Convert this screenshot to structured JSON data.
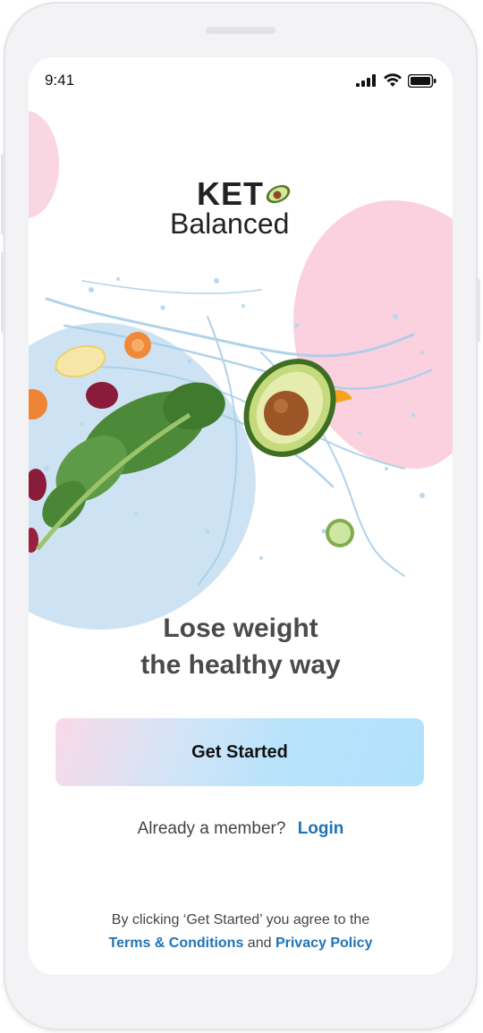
{
  "status_bar": {
    "time": "9:41",
    "icons": [
      "cellular-signal-icon",
      "wifi-icon",
      "battery-icon"
    ]
  },
  "brand": {
    "name_top": "KET",
    "name_bottom": "Balanced",
    "logo_icon": "avocado-icon"
  },
  "hero": {
    "illustration": "vegetables-water-splash-illustration"
  },
  "headline": {
    "line1": "Lose weight",
    "line2": "the healthy way"
  },
  "cta": {
    "label": "Get Started"
  },
  "member": {
    "prompt": "Already a member?",
    "login_label": "Login"
  },
  "legal": {
    "prefix": "By clicking ‘Get Started’ you agree to the",
    "terms_label": "Terms & Conditions",
    "and_text": "and",
    "privacy_label": "Privacy Policy"
  },
  "colors": {
    "accent_blue": "#1f73b7",
    "pink_blob": "#fbd1e0",
    "blue_blob": "#cde3f3",
    "cta_gradient_start": "#f9d9e7",
    "cta_gradient_end": "#b2e1fc"
  }
}
